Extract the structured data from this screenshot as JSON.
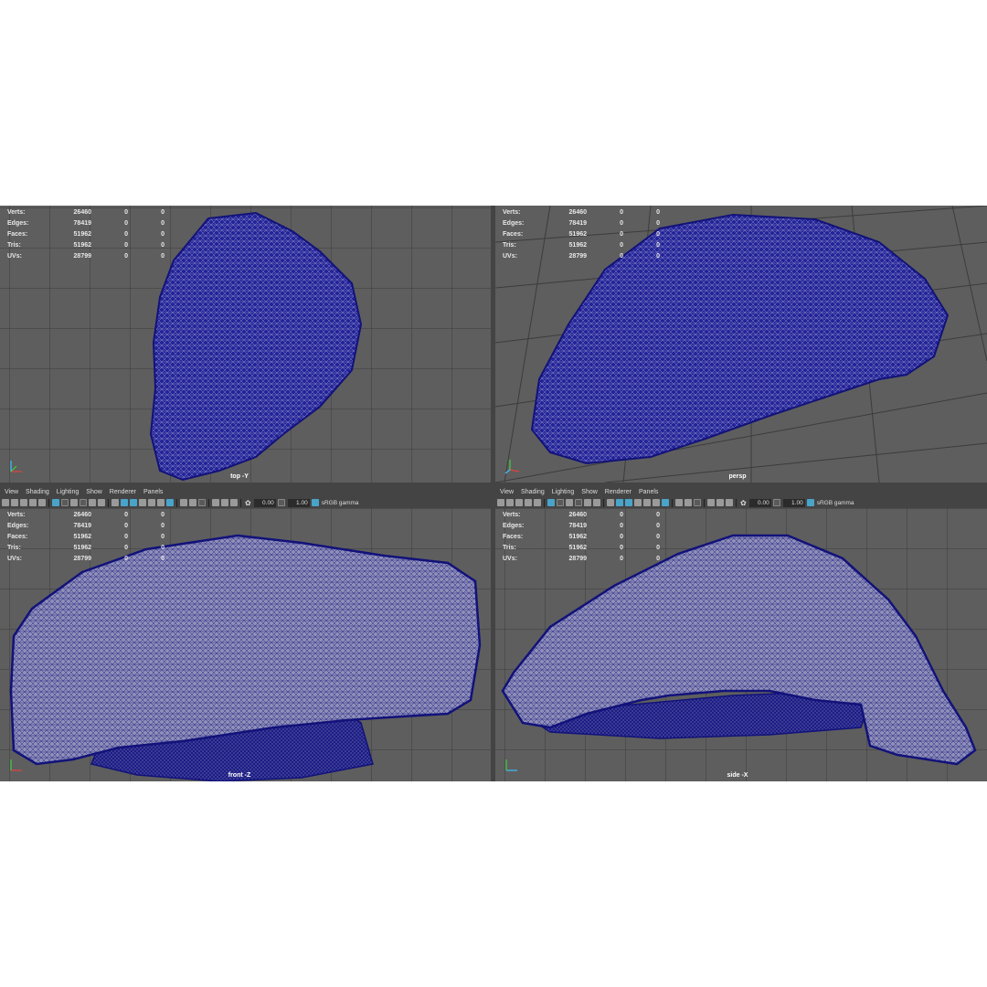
{
  "stats": {
    "rows": [
      {
        "label": "Verts:",
        "value": "26460",
        "sel": "0",
        "comp": "0"
      },
      {
        "label": "Edges:",
        "value": "78419",
        "sel": "0",
        "comp": "0"
      },
      {
        "label": "Faces:",
        "value": "51962",
        "sel": "0",
        "comp": "0"
      },
      {
        "label": "Tris:",
        "value": "51962",
        "sel": "0",
        "comp": "0"
      },
      {
        "label": "UVs:",
        "value": "28799",
        "sel": "0",
        "comp": "0"
      }
    ]
  },
  "viewports": {
    "top": {
      "label": "top -Y"
    },
    "persp": {
      "label": "persp"
    },
    "front": {
      "label": "front -Z"
    },
    "side": {
      "label": "side -X"
    }
  },
  "panel_menu": [
    "View",
    "Shading",
    "Lighting",
    "Show",
    "Renderer",
    "Panels"
  ],
  "toolbar": {
    "exposure": "0.00",
    "gamma_value": "1.00",
    "color_space": "sRGB gamma"
  },
  "colors": {
    "viewport_bg": "#5e5e5e",
    "grid": "#3a3a3a",
    "wireframe": "#1a1a8c",
    "mesh_fill": "#8c8cb8"
  }
}
